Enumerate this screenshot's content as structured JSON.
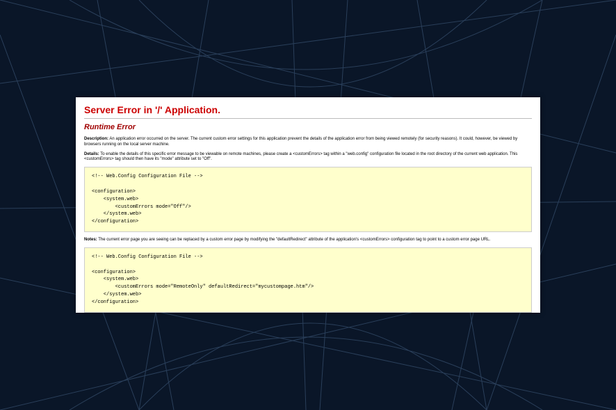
{
  "error": {
    "title": "Server Error in '/' Application.",
    "subtitle": "Runtime Error",
    "description_label": "Description:",
    "description_text": "An application error occurred on the server. The current custom error settings for this application prevent the details of the application error from being viewed remotely (for security reasons). It could, however, be viewed by browsers running on the local server machine.",
    "details_label": "Details:",
    "details_text": "To enable the details of this specific error message to be viewable on remote machines, please create a <customErrors> tag within a \"web.config\" configuration file located in the root directory of the current web application. This <customErrors> tag should then have its \"mode\" attribute set to \"Off\".",
    "code_block_1": "<!-- Web.Config Configuration File -->\n\n<configuration>\n    <system.web>\n        <customErrors mode=\"Off\"/>\n    </system.web>\n</configuration>",
    "notes_label": "Notes:",
    "notes_text": "The current error page you are seeing can be replaced by a custom error page by modifying the \"defaultRedirect\" attribute of the application's <customErrors> configuration tag to point to a custom error page URL.",
    "code_block_2": "<!-- Web.Config Configuration File -->\n\n<configuration>\n    <system.web>\n        <customErrors mode=\"RemoteOnly\" defaultRedirect=\"mycustompage.htm\"/>\n    </system.web>\n</configuration>"
  }
}
